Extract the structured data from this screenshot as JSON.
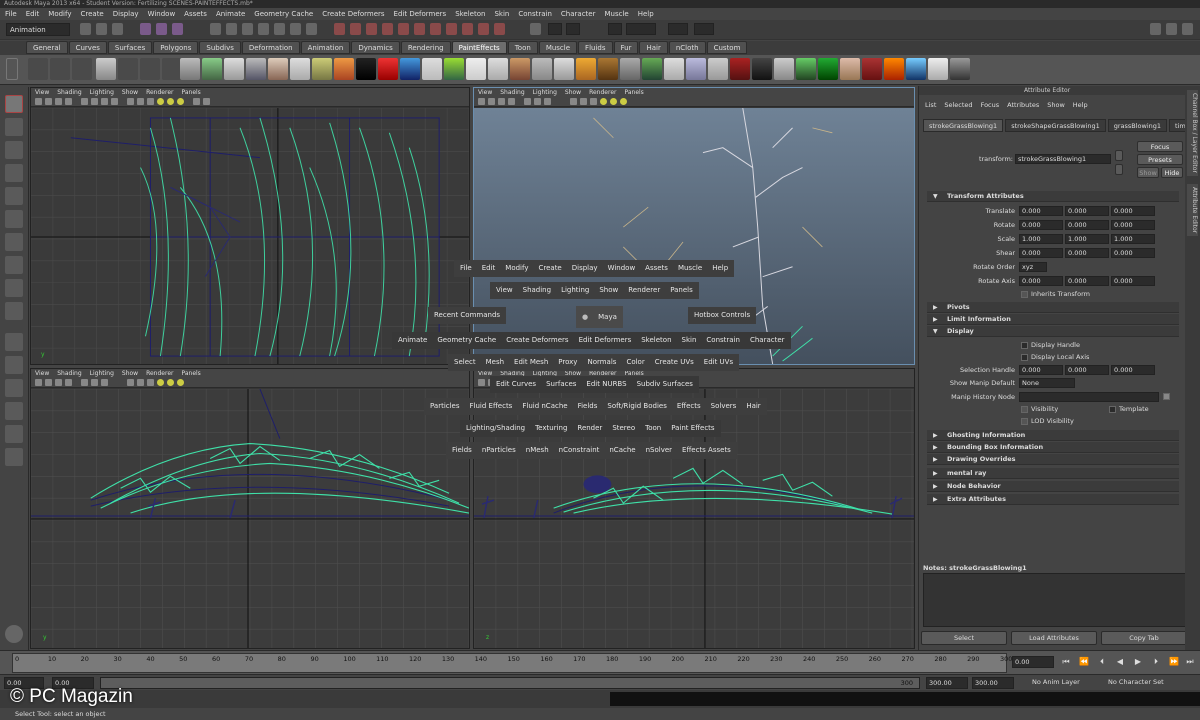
{
  "window_title": "Autodesk Maya 2013 x64 - Student Version: Fertilizing SCENES-PAINTEFFECTS.mb*",
  "main_menu": [
    "File",
    "Edit",
    "Modify",
    "Create",
    "Display",
    "Window",
    "Assets",
    "Animate",
    "Geometry Cache",
    "Create Deformers",
    "Edit Deformers",
    "Skeleton",
    "Skin",
    "Constrain",
    "Character",
    "Muscle",
    "Help"
  ],
  "mode_selector": "Animation",
  "shelf_tabs": [
    "General",
    "Curves",
    "Surfaces",
    "Polygons",
    "Subdivs",
    "Deformation",
    "Animation",
    "Dynamics",
    "Rendering",
    "PaintEffects",
    "Toon",
    "Muscle",
    "Fluids",
    "Fur",
    "Hair",
    "nCloth",
    "Custom"
  ],
  "active_shelf_tab": "PaintEffects",
  "viewport_menu": [
    "View",
    "Shading",
    "Lighting",
    "Show",
    "Renderer",
    "Panels"
  ],
  "hotbox": {
    "row1": [
      "File",
      "Edit",
      "Modify",
      "Create",
      "Display",
      "Window",
      "Assets",
      "Muscle",
      "Help"
    ],
    "row2": [
      "View",
      "Shading",
      "Lighting",
      "Show",
      "Renderer",
      "Panels"
    ],
    "recent": "Recent Commands",
    "center": "Maya",
    "controls": "Hotbox Controls",
    "row3": [
      "Animate",
      "Geometry Cache",
      "Create Deformers",
      "Edit Deformers",
      "Skeleton",
      "Skin",
      "Constrain",
      "Character"
    ],
    "row4": [
      "Select",
      "Mesh",
      "Edit Mesh",
      "Proxy",
      "Normals",
      "Color",
      "Create UVs",
      "Edit UVs"
    ],
    "row5": [
      "Edit Curves",
      "Surfaces",
      "Edit NURBS",
      "Subdiv Surfaces"
    ],
    "row6": [
      "Particles",
      "Fluid Effects",
      "Fluid nCache",
      "Fields",
      "Soft/Rigid Bodies",
      "Effects",
      "Solvers",
      "Hair"
    ],
    "row7": [
      "Lighting/Shading",
      "Texturing",
      "Render",
      "Stereo",
      "Toon",
      "Paint Effects"
    ],
    "row8": [
      "Fields",
      "nParticles",
      "nMesh",
      "nConstraint",
      "nCache",
      "nSolver",
      "Effects Assets"
    ]
  },
  "attribute_editor": {
    "header": "Attribute Editor",
    "menu": [
      "List",
      "Selected",
      "Focus",
      "Attributes",
      "Show",
      "Help"
    ],
    "tabs": [
      "strokeGrassBlowing1",
      "strokeShapeGrassBlowing1",
      "grassBlowing1",
      "time1"
    ],
    "transform_label": "transform:",
    "transform_value": "strokeGrassBlowing1",
    "focus_button": "Focus",
    "presets_button": "Presets",
    "show_button": "Show",
    "hide_button": "Hide",
    "transform_attributes": "Transform Attributes",
    "translate_label": "Translate",
    "translate": [
      "0.000",
      "0.000",
      "0.000"
    ],
    "rotate_label": "Rotate",
    "rotate": [
      "0.000",
      "0.000",
      "0.000"
    ],
    "scale_label": "Scale",
    "scale": [
      "1.000",
      "1.000",
      "1.000"
    ],
    "shear_label": "Shear",
    "shear": [
      "0.000",
      "0.000",
      "0.000"
    ],
    "rotate_order_label": "Rotate Order",
    "rotate_order": "xyz",
    "rotate_axis_label": "Rotate Axis",
    "rotate_axis": [
      "0.000",
      "0.000",
      "0.000"
    ],
    "inherits_transform": "Inherits Transform",
    "pivots": "Pivots",
    "limit_information": "Limit Information",
    "display": "Display",
    "display_handle": "Display Handle",
    "display_local_axis": "Display Local Axis",
    "selection_handle_label": "Selection Handle",
    "selection_handle": [
      "0.000",
      "0.000",
      "0.000"
    ],
    "show_manip_default_label": "Show Manip Default",
    "show_manip_default": "None",
    "manip_history_node_label": "Manip History Node",
    "visibility": "Visibility",
    "template": "Template",
    "lod_visibility": "LOD Visibility",
    "ghosting_information": "Ghosting Information",
    "bounding_box_information": "Bounding Box Information",
    "drawing_overrides": "Drawing Overrides",
    "mental_ray": "mental ray",
    "node_behavior": "Node Behavior",
    "extra_attributes": "Extra Attributes",
    "notes_label": "Notes: strokeGrassBlowing1",
    "select_button": "Select",
    "load_attributes_button": "Load Attributes",
    "copy_tab_button": "Copy Tab"
  },
  "right_strip": [
    "Channel Box / Layer Editor",
    "Attribute Editor"
  ],
  "timeline": {
    "ticks": [
      "0",
      "10",
      "20",
      "30",
      "40",
      "50",
      "60",
      "70",
      "80",
      "90",
      "100",
      "110",
      "120",
      "130",
      "140",
      "150",
      "160",
      "170",
      "180",
      "190",
      "200",
      "210",
      "220",
      "230",
      "240",
      "250",
      "260",
      "270",
      "280",
      "290",
      "300"
    ],
    "current_frame": "0.00"
  },
  "range": {
    "start": "0.00",
    "start_inner": "0.00",
    "end_inner": "300",
    "end": "300.00",
    "anim_end": "300.00",
    "anim_layer": "No Anim Layer",
    "character_set": "No Character Set"
  },
  "help_line": "Select Tool: select an object",
  "watermark": "© PC Magazin",
  "colors": {
    "grass": "#3fe0a8",
    "wire": "#1a1a66",
    "viewport_bg": "#3a3a3a",
    "persp_sky": "#5b6e82"
  }
}
